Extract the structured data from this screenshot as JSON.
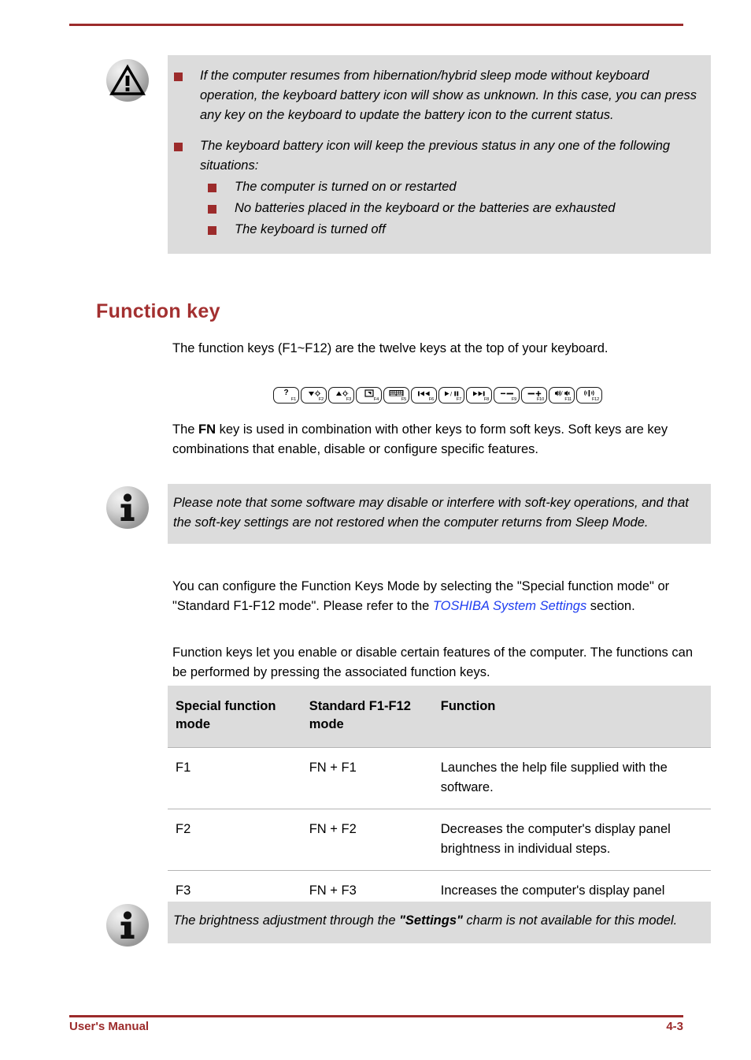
{
  "page": {
    "footer_left": "User's Manual",
    "footer_right": "4-3",
    "rule_color": "#9c2b2b"
  },
  "warning_box": {
    "icon": "warning-triangle-icon",
    "bullets": [
      {
        "text": "If the computer resumes from hibernation/hybrid sleep mode without keyboard operation, the keyboard battery icon will show as unknown. In this case, you can press any key on the keyboard to update the battery icon to the current status."
      },
      {
        "text": "The keyboard battery icon will keep the previous status in any one of the following situations:",
        "subbullets": [
          "The computer is turned on or restarted",
          "No batteries placed in the keyboard or the batteries are exhausted",
          "The keyboard is turned off"
        ]
      }
    ]
  },
  "heading": "Function key",
  "intro_paragraph": "The function keys (F1~F12) are the twelve keys at the top of your keyboard.",
  "function_keys": [
    {
      "glyph": "question-mark",
      "label": "F1"
    },
    {
      "glyph": "brightness-down",
      "label": "F2"
    },
    {
      "glyph": "brightness-up",
      "label": "F3"
    },
    {
      "glyph": "display-output",
      "label": "F4"
    },
    {
      "glyph": "keyboard-backlight",
      "label": "F5"
    },
    {
      "glyph": "previous-track",
      "label": "F6"
    },
    {
      "glyph": "play-pause",
      "label": "F7"
    },
    {
      "glyph": "next-track",
      "label": "F8"
    },
    {
      "glyph": "volume-down-bar",
      "label": "F9"
    },
    {
      "glyph": "volume-up-bar",
      "label": "F10"
    },
    {
      "glyph": "mute-toggle",
      "label": "F11"
    },
    {
      "glyph": "wireless-toggle",
      "label": "F12"
    }
  ],
  "fn_paragraph": {
    "pre": "The ",
    "bold": "FN",
    "post": " key is used in combination with other keys to form soft keys. Soft keys are key combinations that enable, disable or configure specific features."
  },
  "info_box_1": {
    "icon": "information-icon",
    "text": "Please note that some software may disable or interfere with soft-key operations, and that the soft-key settings are not restored when the computer returns from Sleep Mode."
  },
  "config_paragraph": {
    "pre": "You can configure the Function Keys Mode by selecting the \"Special function mode\" or \"Standard F1-F12 mode\". Please refer to the ",
    "link": "TOSHIBA System Settings",
    "post": " section."
  },
  "features_paragraph": "Function keys let you enable or disable certain features of the computer. The functions can be performed by pressing the associated function keys.",
  "table": {
    "headers": [
      "Special function mode",
      "Standard F1-F12 mode",
      "Function"
    ],
    "rows": [
      {
        "special": "F1",
        "standard": "FN + F1",
        "function": "Launches the help file supplied with the software."
      },
      {
        "special": "F2",
        "standard": "FN + F2",
        "function": "Decreases the computer's display panel brightness in individual steps."
      },
      {
        "special": "F3",
        "standard": "FN + F3",
        "function": "Increases the computer's display panel brightness in individual steps."
      }
    ]
  },
  "info_box_2": {
    "icon": "information-icon",
    "pre": "The brightness adjustment through the ",
    "bold": "\"Settings\"",
    "post": " charm is not available for this model."
  }
}
